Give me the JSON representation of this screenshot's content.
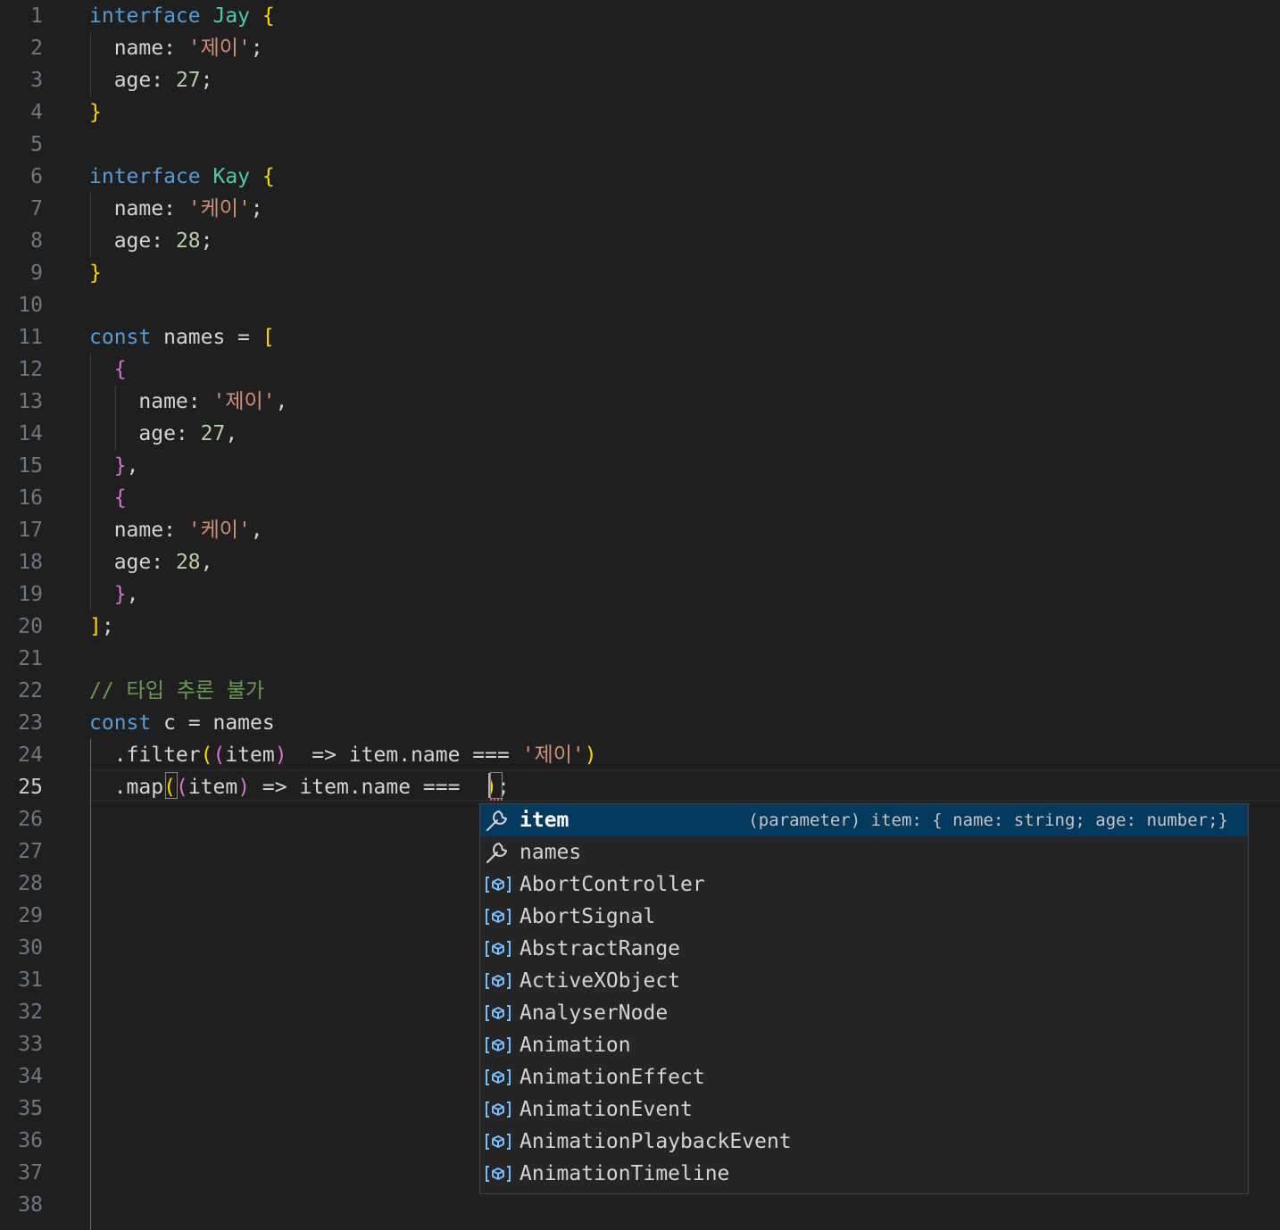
{
  "editor": {
    "active_line": 25,
    "line_numbers": [
      "1",
      "2",
      "3",
      "4",
      "5",
      "6",
      "7",
      "8",
      "9",
      "10",
      "11",
      "12",
      "13",
      "14",
      "15",
      "16",
      "17",
      "18",
      "19",
      "20",
      "21",
      "22",
      "23",
      "24",
      "25",
      "26",
      "27",
      "28",
      "29",
      "30",
      "31",
      "32",
      "33",
      "34",
      "35",
      "36",
      "37",
      "38"
    ],
    "lines": [
      [
        {
          "t": "interface",
          "c": "kw"
        },
        {
          "t": " "
        },
        {
          "t": "Jay",
          "c": "tp"
        },
        {
          "t": " "
        },
        {
          "t": "{",
          "c": "b1"
        }
      ],
      [
        {
          "t": "  name: "
        },
        {
          "t": "'제이'",
          "c": "str"
        },
        {
          "t": ";"
        }
      ],
      [
        {
          "t": "  age: "
        },
        {
          "t": "27",
          "c": "num"
        },
        {
          "t": ";"
        }
      ],
      [
        {
          "t": "}",
          "c": "b1"
        }
      ],
      [],
      [
        {
          "t": "interface",
          "c": "kw"
        },
        {
          "t": " "
        },
        {
          "t": "Kay",
          "c": "tp"
        },
        {
          "t": " "
        },
        {
          "t": "{",
          "c": "b1"
        }
      ],
      [
        {
          "t": "  name: "
        },
        {
          "t": "'케이'",
          "c": "str"
        },
        {
          "t": ";"
        }
      ],
      [
        {
          "t": "  age: "
        },
        {
          "t": "28",
          "c": "num"
        },
        {
          "t": ";"
        }
      ],
      [
        {
          "t": "}",
          "c": "b1"
        }
      ],
      [],
      [
        {
          "t": "const",
          "c": "kw"
        },
        {
          "t": " names = "
        },
        {
          "t": "[",
          "c": "b1"
        }
      ],
      [
        {
          "t": "  "
        },
        {
          "t": "{",
          "c": "b2"
        }
      ],
      [
        {
          "t": "    name: "
        },
        {
          "t": "'제이'",
          "c": "str"
        },
        {
          "t": ","
        }
      ],
      [
        {
          "t": "    age: "
        },
        {
          "t": "27",
          "c": "num"
        },
        {
          "t": ","
        }
      ],
      [
        {
          "t": "  "
        },
        {
          "t": "}",
          "c": "b2"
        },
        {
          "t": ","
        }
      ],
      [
        {
          "t": "  "
        },
        {
          "t": "{",
          "c": "b2"
        }
      ],
      [
        {
          "t": "  name: "
        },
        {
          "t": "'케이'",
          "c": "str"
        },
        {
          "t": ","
        }
      ],
      [
        {
          "t": "  age: "
        },
        {
          "t": "28",
          "c": "num"
        },
        {
          "t": ","
        }
      ],
      [
        {
          "t": "  "
        },
        {
          "t": "}",
          "c": "b2"
        },
        {
          "t": ","
        }
      ],
      [
        {
          "t": "]",
          "c": "b1"
        },
        {
          "t": ";"
        }
      ],
      [],
      [
        {
          "t": "// 타입 추론 불가",
          "c": "cm"
        }
      ],
      [
        {
          "t": "const",
          "c": "kw"
        },
        {
          "t": " c = names"
        }
      ],
      [
        {
          "t": "  .filter"
        },
        {
          "t": "(",
          "c": "b1"
        },
        {
          "t": "(",
          "c": "b2"
        },
        {
          "t": "item"
        },
        {
          "t": ")",
          "c": "b2"
        },
        {
          "t": "  => item.name === "
        },
        {
          "t": "'제이'",
          "c": "str"
        },
        {
          "t": ")",
          "c": "b1"
        }
      ],
      [
        {
          "t": "  .map"
        },
        {
          "t": "(",
          "c": "b1"
        },
        {
          "t": "(",
          "c": "b2"
        },
        {
          "t": "item"
        },
        {
          "t": ")",
          "c": "b2"
        },
        {
          "t": " => item.name ===  "
        },
        {
          "t": ")",
          "c": "b1"
        },
        {
          "t": ";"
        }
      ],
      [],
      [],
      [],
      [],
      [],
      [],
      [],
      [],
      [],
      [],
      [],
      [],
      []
    ]
  },
  "suggest": {
    "items": [
      {
        "label": "item",
        "icon": "wrench-icon",
        "detail": "(parameter) item: { name: string; age: number;}",
        "selected": true
      },
      {
        "label": "names",
        "icon": "wrench-icon",
        "detail": "",
        "selected": false
      },
      {
        "label": "AbortController",
        "icon": "variable-icon",
        "detail": "",
        "selected": false
      },
      {
        "label": "AbortSignal",
        "icon": "variable-icon",
        "detail": "",
        "selected": false
      },
      {
        "label": "AbstractRange",
        "icon": "variable-icon",
        "detail": "",
        "selected": false
      },
      {
        "label": "ActiveXObject",
        "icon": "variable-icon",
        "detail": "",
        "selected": false
      },
      {
        "label": "AnalyserNode",
        "icon": "variable-icon",
        "detail": "",
        "selected": false
      },
      {
        "label": "Animation",
        "icon": "variable-icon",
        "detail": "",
        "selected": false
      },
      {
        "label": "AnimationEffect",
        "icon": "variable-icon",
        "detail": "",
        "selected": false
      },
      {
        "label": "AnimationEvent",
        "icon": "variable-icon",
        "detail": "",
        "selected": false
      },
      {
        "label": "AnimationPlaybackEvent",
        "icon": "variable-icon",
        "detail": "",
        "selected": false
      },
      {
        "label": "AnimationTimeline",
        "icon": "variable-icon",
        "detail": "",
        "selected": false
      }
    ]
  }
}
